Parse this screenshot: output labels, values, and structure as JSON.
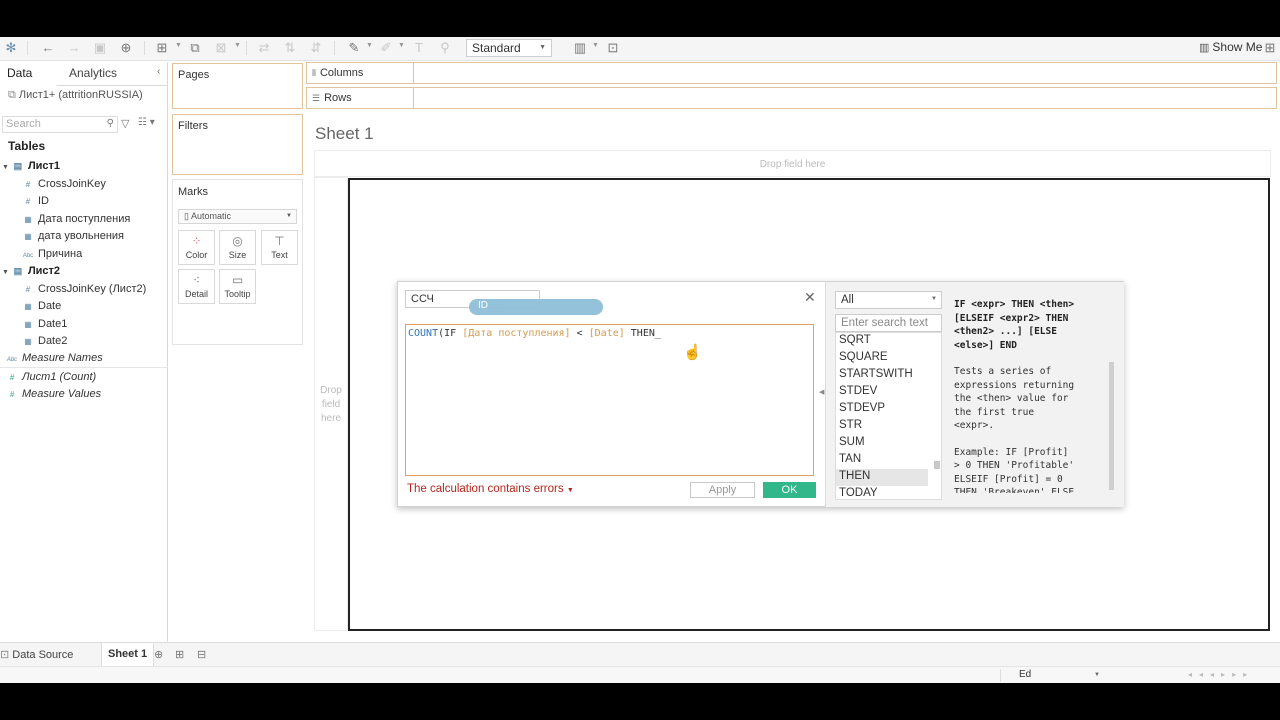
{
  "toolbar": {
    "format_select": "Standard",
    "show_me": "Show Me",
    "icons": [
      "tableau-logo-icon",
      "undo-icon",
      "redo-icon",
      "save-icon",
      "add-datasource-icon",
      "new-sheet-icon",
      "duplicate-icon",
      "clear-icon",
      "swap-icon",
      "sort-asc-icon",
      "sort-desc-icon",
      "highlight-icon",
      "group-icon",
      "labels-icon",
      "fix-axes-icon",
      "fit-icon",
      "presentation-icon",
      "show-me-icon"
    ]
  },
  "data_pane": {
    "tabs": [
      "Data",
      "Analytics"
    ],
    "datasource": "Лист1+ (attritionRUSSIA)",
    "search_placeholder": "Search",
    "tables_title": "Tables",
    "table1": {
      "name": "Лист1",
      "fields": [
        {
          "type": "#",
          "name": "CrossJoinKey"
        },
        {
          "type": "#",
          "name": "ID"
        },
        {
          "type": "date",
          "name": "Дата поступления"
        },
        {
          "type": "date",
          "name": "дата увольнения"
        },
        {
          "type": "Abc",
          "name": "Причина"
        }
      ]
    },
    "table2": {
      "name": "Лист2",
      "fields": [
        {
          "type": "#",
          "name": "CrossJoinKey (Лист2)"
        },
        {
          "type": "date",
          "name": "Date"
        },
        {
          "type": "date",
          "name": "Date1"
        },
        {
          "type": "date",
          "name": "Date2"
        }
      ]
    },
    "measure_names": "Measure Names",
    "count_field": "Лист1 (Count)",
    "measure_values": "Measure Values"
  },
  "shelves": {
    "pages": "Pages",
    "filters": "Filters",
    "marks": "Marks",
    "columns": "Columns",
    "rows": "Rows",
    "marks_type": "Automatic",
    "mark_buttons": [
      "Color",
      "Size",
      "Text",
      "Detail",
      "Tooltip"
    ]
  },
  "canvas": {
    "sheet_title": "Sheet 1",
    "drop_top": "Drop field here",
    "drop_left": "Drop field here"
  },
  "calc": {
    "name": "ССЧ",
    "drag_pill": "ID",
    "code": {
      "fn": "COUNT",
      "p1": "(IF ",
      "f1": "[Дата поступления]",
      "op": " < ",
      "f2": "[Date]",
      "p2": " THEN_"
    },
    "error": "The calculation contains errors",
    "apply": "Apply",
    "ok": "OK",
    "category": "All",
    "search_placeholder": "Enter search text",
    "functions": [
      "SQRT",
      "SQUARE",
      "STARTSWITH",
      "STDEV",
      "STDEVP",
      "STR",
      "SUM",
      "TAN",
      "THEN",
      "TODAY"
    ],
    "selected_function": "THEN",
    "help_signature": "IF <expr> THEN <then>\n[ELSEIF <expr2> THEN\n<then2> ...] [ELSE\n<else>] END",
    "help_text": "Tests a series of\nexpressions returning\nthe <then> value for\nthe first true\n<expr>.",
    "help_example": "Example: IF [Profit]\n> 0 THEN 'Profitable'\nELSEIF [Profit] = 0\nTHEN 'Breakeven' ELSE"
  },
  "bottom": {
    "data_source": "Data Source",
    "sheet_tab": "Sheet 1",
    "user": "Ed"
  },
  "colors": {
    "accent_ok": "#31b78a",
    "error": "#b3261e",
    "shelf_border": "#e2c49c",
    "pill": "#8fbfd9"
  }
}
